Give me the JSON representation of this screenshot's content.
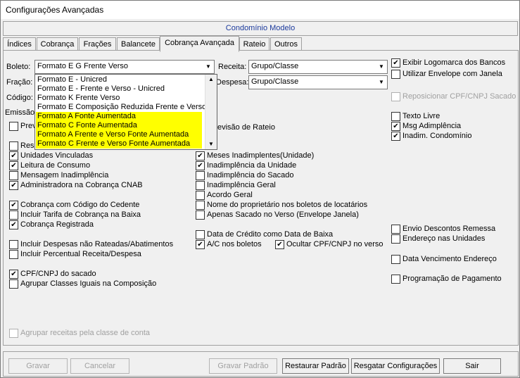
{
  "window": {
    "title": "Configurações Avançadas"
  },
  "banner": {
    "text": "Condomínio Modelo"
  },
  "tabs": [
    {
      "label": "Índices"
    },
    {
      "label": "Cobrança"
    },
    {
      "label": "Frações"
    },
    {
      "label": "Balancete"
    },
    {
      "label": "Cobrança Avançada",
      "active": true
    },
    {
      "label": "Rateio"
    },
    {
      "label": "Outros"
    }
  ],
  "fields": {
    "boleto_label": "Boleto:",
    "boleto_value": "Formato E G Frente Verso",
    "fracao_label": "Fração:",
    "codigo_label": "Código:",
    "emissao_label": "Emissão:",
    "receita_label": "Receita:",
    "receita_value": "Grupo/Classe",
    "despesa_label": "Despesa:",
    "despesa_value": "Grupo/Classe"
  },
  "boleto_dropdown": {
    "options": [
      {
        "label": "Formato E - Unicred",
        "highlight": false
      },
      {
        "label": "Formato E - Frente e Verso - Unicred",
        "highlight": false
      },
      {
        "label": "Formato K Frente Verso",
        "highlight": false
      },
      {
        "label": "Formato E Composição Reduzida Frente e Verso",
        "highlight": false
      },
      {
        "label": "Formato A Fonte Aumentada",
        "highlight": true
      },
      {
        "label": "Formato C Fonte Aumentada",
        "highlight": true
      },
      {
        "label": "Formato A Frente e Verso Fonte Aumentada",
        "highlight": true
      },
      {
        "label": "Formato C Frente e Verso Fonte Aumentada",
        "highlight": true
      }
    ]
  },
  "partial_labels": {
    "pre": "Prev",
    "res": "Res",
    "revisao": "evisão de Rateio"
  },
  "col1": [
    {
      "label": "Unidades Vinculadas",
      "checked": true
    },
    {
      "label": "Leitura de Consumo",
      "checked": true
    },
    {
      "label": "Mensagem Inadimplência",
      "checked": false
    },
    {
      "label": "Administradora na Cobrança CNAB",
      "checked": true
    },
    {
      "label": "Cobrança com Código do Cedente",
      "checked": true
    },
    {
      "label": "Incluir Tarifa de Cobrança na Baixa",
      "checked": false
    },
    {
      "label": "Cobrança Registrada",
      "checked": true
    },
    {
      "label": "Incluir Despesas não Rateadas/Abatimentos",
      "checked": false
    },
    {
      "label": "Incluir Percentual Receita/Despesa",
      "checked": false
    },
    {
      "label": "CPF/CNPJ do sacado",
      "checked": true
    },
    {
      "label": "Agrupar Classes Iguais na Composição",
      "checked": false
    },
    {
      "label": "Agrupar receitas pela classe de conta",
      "checked": false,
      "disabled": true
    }
  ],
  "col2": [
    {
      "label": "Meses Inadimplentes(Unidade)",
      "checked": true
    },
    {
      "label": "Inadimplência da Unidade",
      "checked": true
    },
    {
      "label": "Inadimplência do Sacado",
      "checked": false
    },
    {
      "label": "Inadimplência Geral",
      "checked": false
    },
    {
      "label": "Acordo Geral",
      "checked": false
    },
    {
      "label": "Nome do proprietário nos boletos de locatários",
      "checked": false
    },
    {
      "label": "Apenas Sacado no Verso (Envelope Janela)",
      "checked": false
    },
    {
      "label": "Data de Crédito como Data de Baixa",
      "checked": false
    },
    {
      "label": "A/C nos boletos",
      "checked": true
    },
    {
      "label": "Ocultar CPF/CNPJ no verso",
      "checked": true
    }
  ],
  "col3": [
    {
      "label": "Exibir Logomarca dos Bancos",
      "checked": true
    },
    {
      "label": "Utilizar Envelope com Janela",
      "checked": false
    },
    {
      "label": "Reposicionar CPF/CNPJ Sacado",
      "checked": false,
      "disabled": true
    },
    {
      "label": "Texto Livre",
      "checked": false
    },
    {
      "label": "Msg Adimplência",
      "checked": true
    },
    {
      "label": "Inadim. Condomínio",
      "checked": true
    },
    {
      "label": "Envio Descontos Remessa",
      "checked": false
    },
    {
      "label": "Endereço nas Unidades",
      "checked": false
    },
    {
      "label": "Data Vencimento Endereço",
      "checked": false
    },
    {
      "label": "Programação de Pagamento",
      "checked": false
    }
  ],
  "buttons": {
    "gravar": "Gravar",
    "cancelar": "Cancelar",
    "gravar_padrao": "Gravar Padrão",
    "restaurar_padrao": "Restaurar Padrão",
    "resgatar": "Resgatar Configurações",
    "sair": "Sair"
  }
}
